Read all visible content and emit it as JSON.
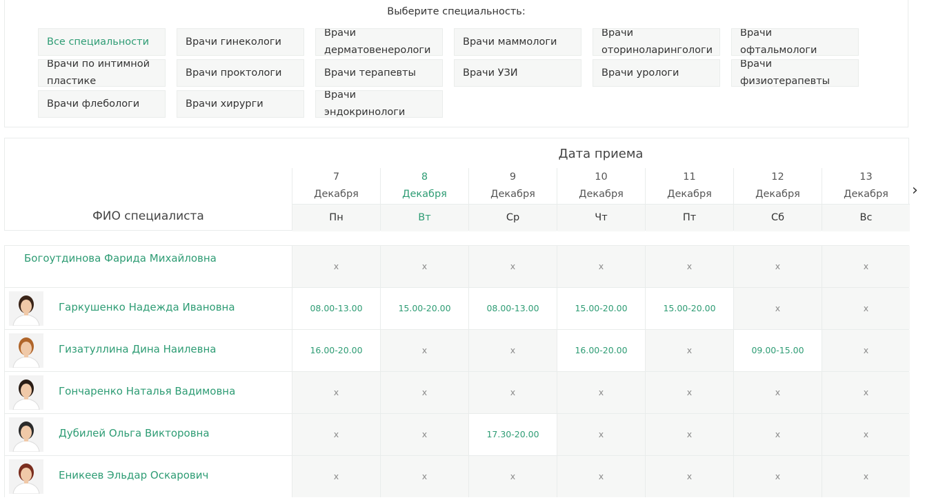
{
  "specialty_panel": {
    "title": "Выберите специальность:",
    "buttons": [
      {
        "label": "Все специальности",
        "active": true
      },
      {
        "label": "Врачи гинекологи"
      },
      {
        "label": "Врачи дерматовенерологи"
      },
      {
        "label": "Врачи маммологи"
      },
      {
        "label": "Врачи оториноларингологи"
      },
      {
        "label": "Врачи офтальмологи"
      },
      {
        "label": "Врачи по интимной пластике"
      },
      {
        "label": "Врачи проктологи"
      },
      {
        "label": "Врачи терапевты"
      },
      {
        "label": "Врачи УЗИ"
      },
      {
        "label": "Врачи урологи"
      },
      {
        "label": "Врачи физиотерапевты"
      },
      {
        "label": "Врачи флебологи"
      },
      {
        "label": "Врачи хирурги"
      },
      {
        "label": "Врачи эндокринологи"
      }
    ]
  },
  "schedule": {
    "date_title": "Дата приема",
    "fio_header": "ФИО специалиста",
    "days": [
      {
        "num": "7",
        "month": "Декабря",
        "weekday": "Пн"
      },
      {
        "num": "8",
        "month": "Декабря",
        "weekday": "Вт",
        "active": true
      },
      {
        "num": "9",
        "month": "Декабря",
        "weekday": "Ср"
      },
      {
        "num": "10",
        "month": "Декабря",
        "weekday": "Чт"
      },
      {
        "num": "11",
        "month": "Декабря",
        "weekday": "Пт"
      },
      {
        "num": "12",
        "month": "Декабря",
        "weekday": "Сб"
      },
      {
        "num": "13",
        "month": "Декабря",
        "weekday": "Вс"
      }
    ],
    "next_arrow": "›",
    "doctors": [
      {
        "name": "Богоутдинова Фарида Михайловна",
        "photo": false,
        "slots": [
          "x",
          "x",
          "x",
          "x",
          "x",
          "x",
          "x"
        ]
      },
      {
        "name": "Гаркушенко Надежда Ивановна",
        "photo": true,
        "slots": [
          "08.00-13.00",
          "15.00-20.00",
          "08.00-13.00",
          "15.00-20.00",
          "15.00-20.00",
          "x",
          "x"
        ]
      },
      {
        "name": "Гизатуллина Дина Наилевна",
        "photo": true,
        "slots": [
          "16.00-20.00",
          "x",
          "x",
          "16.00-20.00",
          "x",
          "09.00-15.00",
          "x"
        ]
      },
      {
        "name": "Гончаренко Наталья Вадимовна",
        "photo": true,
        "slots": [
          "x",
          "x",
          "x",
          "x",
          "x",
          "x",
          "x"
        ]
      },
      {
        "name": "Дубилей Ольга Викторовна",
        "photo": true,
        "slots": [
          "x",
          "x",
          "17.30-20.00",
          "x",
          "x",
          "x",
          "x"
        ]
      },
      {
        "name": "Еникеев Эльдар Оскарович",
        "photo": true,
        "slots": [
          "x",
          "x",
          "x",
          "x",
          "x",
          "x",
          "x"
        ]
      }
    ]
  },
  "colors": {
    "accent": "#2e9c74",
    "cell_bg": "#f6f7f6",
    "border": "#e9eceb"
  }
}
